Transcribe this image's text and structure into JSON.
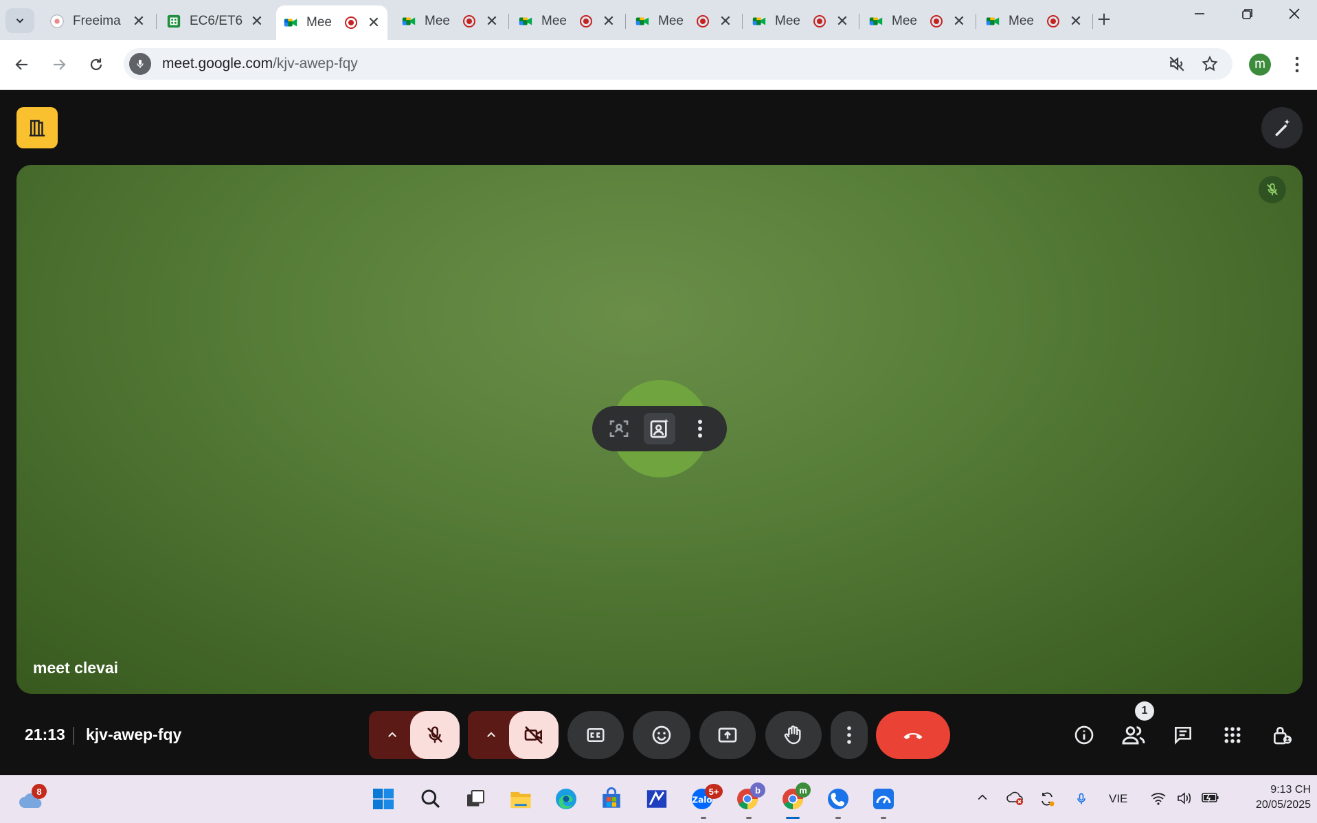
{
  "tabs": [
    {
      "title": "Freeima",
      "favicon": "freeimage-favicon",
      "recording": false
    },
    {
      "title": "EC6/ET6",
      "favicon": "sheets-favicon",
      "recording": false
    },
    {
      "title": "Mee",
      "favicon": "meet-favicon",
      "recording": true,
      "active": true
    },
    {
      "title": "Mee",
      "favicon": "meet-favicon",
      "recording": true
    },
    {
      "title": "Mee",
      "favicon": "meet-favicon",
      "recording": true
    },
    {
      "title": "Mee",
      "favicon": "meet-favicon",
      "recording": true
    },
    {
      "title": "Mee",
      "favicon": "meet-favicon",
      "recording": true
    },
    {
      "title": "Mee",
      "favicon": "meet-favicon",
      "recording": true
    },
    {
      "title": "Mee",
      "favicon": "meet-favicon",
      "recording": true
    }
  ],
  "address": {
    "host": "meet.google.com",
    "path": "/kjv-awep-fqy"
  },
  "profile": {
    "initial": "m",
    "color": "#3c8c3c"
  },
  "meet": {
    "tile_name": "meet clevai",
    "time": "21:13",
    "meeting_code": "kjv-awep-fqy",
    "participant_count": "1",
    "colors": {
      "leave": "#ea4335",
      "muted_bg": "#f9dedc",
      "companion": "#f9c02f"
    }
  },
  "taskbar": {
    "weather_badge": "8",
    "zalo_badge": "5+",
    "chrome_b_badge": "b",
    "chrome_m_badge": "m",
    "language": "VIE",
    "time": "9:13 CH",
    "date": "20/05/2025"
  }
}
